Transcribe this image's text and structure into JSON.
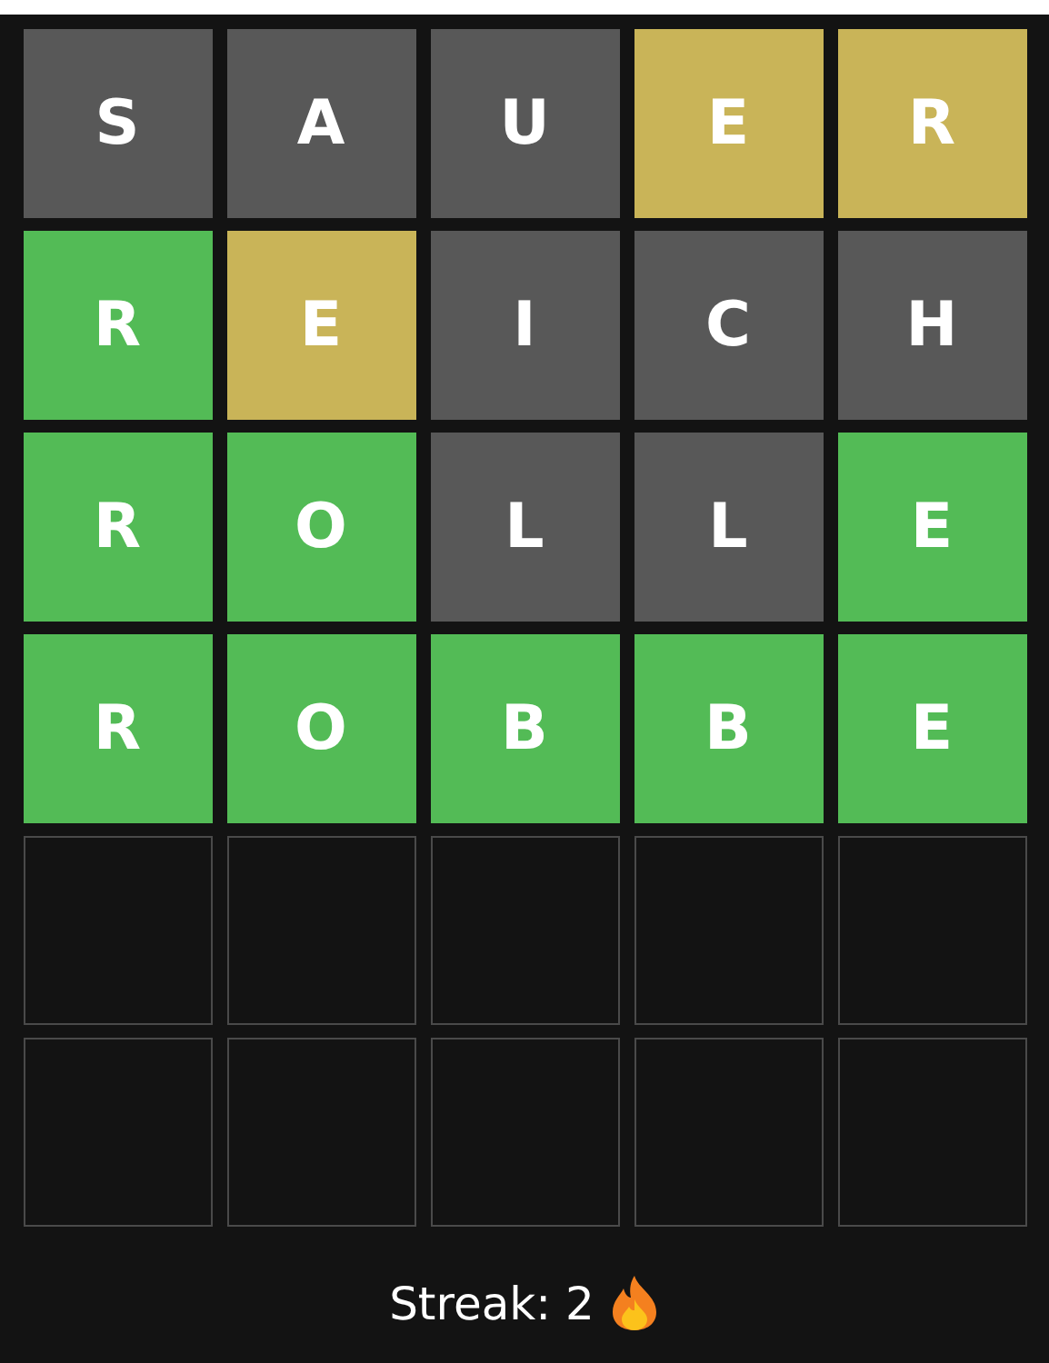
{
  "board": {
    "rows": [
      {
        "tiles": [
          {
            "letter": "S",
            "kind": "absent"
          },
          {
            "letter": "A",
            "kind": "absent"
          },
          {
            "letter": "U",
            "kind": "absent"
          },
          {
            "letter": "E",
            "kind": "present"
          },
          {
            "letter": "R",
            "kind": "present"
          }
        ]
      },
      {
        "tiles": [
          {
            "letter": "R",
            "kind": "correct"
          },
          {
            "letter": "E",
            "kind": "present"
          },
          {
            "letter": "I",
            "kind": "absent"
          },
          {
            "letter": "C",
            "kind": "absent"
          },
          {
            "letter": "H",
            "kind": "absent"
          }
        ]
      },
      {
        "tiles": [
          {
            "letter": "R",
            "kind": "correct"
          },
          {
            "letter": "O",
            "kind": "correct"
          },
          {
            "letter": "L",
            "kind": "absent"
          },
          {
            "letter": "L",
            "kind": "absent"
          },
          {
            "letter": "E",
            "kind": "correct"
          }
        ]
      },
      {
        "tiles": [
          {
            "letter": "R",
            "kind": "correct"
          },
          {
            "letter": "O",
            "kind": "correct"
          },
          {
            "letter": "B",
            "kind": "correct"
          },
          {
            "letter": "B",
            "kind": "correct"
          },
          {
            "letter": "E",
            "kind": "correct"
          }
        ]
      },
      {
        "tiles": [
          {
            "kind": "empty"
          },
          {
            "kind": "empty"
          },
          {
            "kind": "empty"
          },
          {
            "kind": "empty"
          },
          {
            "kind": "empty"
          }
        ]
      },
      {
        "tiles": [
          {
            "kind": "empty"
          },
          {
            "kind": "empty"
          },
          {
            "kind": "empty"
          },
          {
            "kind": "empty"
          },
          {
            "kind": "empty"
          }
        ]
      }
    ]
  },
  "streak": {
    "label": "Streak: 2"
  }
}
